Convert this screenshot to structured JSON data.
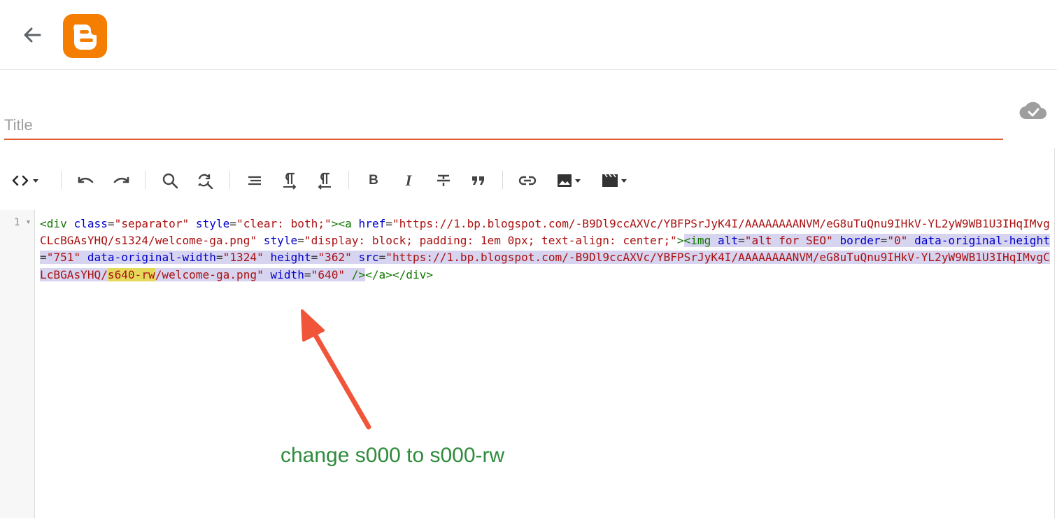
{
  "header": {
    "back_icon": "arrow-left-icon",
    "logo_icon": "blogger-logo-icon",
    "brand_color": "#f57d00"
  },
  "post": {
    "title_placeholder": "Title",
    "title_value": "",
    "save_status_icon": "cloud-done-icon"
  },
  "toolbar": {
    "items": [
      {
        "name": "html-view-toggle",
        "icon": "code-icon"
      },
      {
        "name": "undo",
        "icon": "undo-icon"
      },
      {
        "name": "redo",
        "icon": "redo-icon"
      },
      {
        "name": "search",
        "icon": "search-icon"
      },
      {
        "name": "find-replace",
        "icon": "find-replace-icon"
      },
      {
        "name": "format",
        "icon": "align-lines-icon"
      },
      {
        "name": "ltr",
        "icon": "paragraph-ltr-icon"
      },
      {
        "name": "rtl",
        "icon": "paragraph-rtl-icon"
      },
      {
        "name": "bold",
        "icon": "bold-icon"
      },
      {
        "name": "italic",
        "icon": "italic-icon"
      },
      {
        "name": "strikethrough",
        "icon": "strikethrough-icon"
      },
      {
        "name": "quote",
        "icon": "quote-icon"
      },
      {
        "name": "link",
        "icon": "link-icon"
      },
      {
        "name": "insert-image",
        "icon": "image-icon"
      },
      {
        "name": "insert-video",
        "icon": "video-icon"
      }
    ],
    "bold_glyph": "B",
    "italic_glyph": "I"
  },
  "editor": {
    "line_number": "1",
    "tokens": {
      "t1": "<div",
      "a1": "class",
      "s1": "\"separator\"",
      "a2": "style",
      "s2": "\"clear: both;\"",
      "t2": "><a",
      "a3": "href",
      "s3": "\"https://1.bp.blogspot.com/-B9Dl9ccAXVc/YBFPSrJyK4I/AAAAAAAANVM/eG8uTuQnu9IHkV-YL2yW9WB1U3IHqIMvgCLcBGAsYHQ/s1324/welcome-ga.png\"",
      "a4": "style",
      "s4": "\"display: block; padding: 1em 0px; text-align: center;\"",
      "t3": ">",
      "t4": "<img",
      "a5": "alt",
      "s5": "\"alt for SEO\"",
      "a6": "border",
      "s6": "\"0\"",
      "a7": "data-original-height",
      "s7": "\"751\"",
      "a8": "data-original-width",
      "s8": "\"1324\"",
      "a9": "height",
      "s9": "\"362\"",
      "a10": "src",
      "s10a": "\"https://1.bp.blogspot.com/-B9Dl9ccAXVc/YBFPSrJyK4I/AAAAAAAANVM/eG8uTuQnu9IHkV-YL2yW9WB1U3IHqIMvgCLcBGAsYHQ/",
      "s10b": "s640-rw",
      "s10c": "/welcome-ga.png\"",
      "a11": "width",
      "s11": "\"640\"",
      "t5": "/>",
      "t6": "</a></div>"
    }
  },
  "annotation": {
    "text": "change s000 to s000-rw",
    "arrow_color": "#f0553a",
    "text_color": "#2e8b3c"
  }
}
